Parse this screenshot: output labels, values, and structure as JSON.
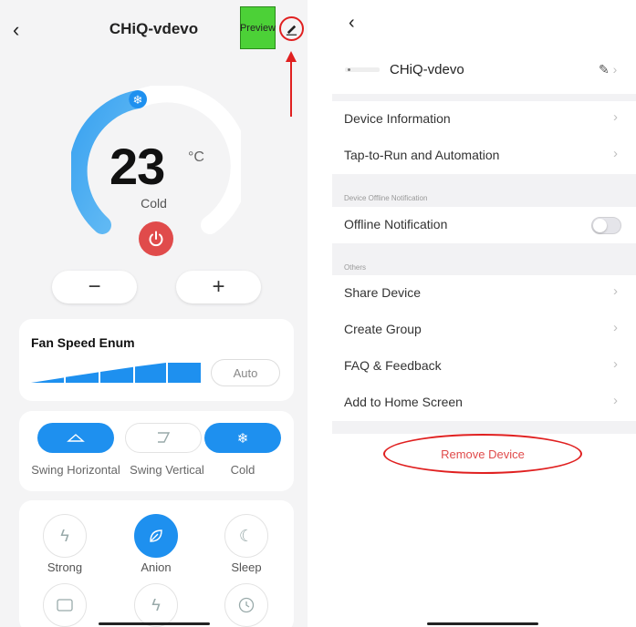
{
  "left": {
    "header": {
      "back_icon": "chevron-left-icon",
      "title": "CHiQ-vdevo",
      "preview_label": "Preview",
      "edit_icon": "pencil-icon"
    },
    "dial": {
      "temperature": "23",
      "unit": "°C",
      "mode": "Cold",
      "snowflake_icon": "snowflake-icon",
      "power_icon": "power-icon"
    },
    "controls": {
      "minus_label": "−",
      "plus_label": "+"
    },
    "fan_speed": {
      "title": "Fan Speed Enum",
      "auto_label": "Auto",
      "level": 5,
      "max_level": 5
    },
    "modes": [
      {
        "label": "Swing Horizontal",
        "icon": "swing-horizontal-icon",
        "active": true
      },
      {
        "label": "Swing Vertical",
        "icon": "swing-vertical-icon",
        "active": false
      },
      {
        "label": "Cold",
        "icon": "snowflake-icon",
        "active": true
      }
    ],
    "functions": [
      {
        "label": "Strong",
        "icon": "lightning-icon",
        "active": false
      },
      {
        "label": "Anion",
        "icon": "leaf-icon",
        "active": true
      },
      {
        "label": "Sleep",
        "icon": "moon-icon",
        "active": false
      }
    ],
    "colors": {
      "accent": "#1e90ef",
      "power": "#e04b4b",
      "annotation": "#e02020"
    }
  },
  "right": {
    "device": {
      "name": "CHiQ-vdevo"
    },
    "rows_top": [
      {
        "label": "Device Information"
      },
      {
        "label": "Tap-to-Run and Automation"
      }
    ],
    "offline_section": {
      "header": "Device Offline Notification",
      "label": "Offline Notification",
      "enabled": false
    },
    "others_section": {
      "header": "Others"
    },
    "rows_others": [
      {
        "label": "Share Device"
      },
      {
        "label": "Create Group"
      },
      {
        "label": "FAQ & Feedback"
      },
      {
        "label": "Add to Home Screen"
      }
    ],
    "remove_label": "Remove Device"
  }
}
